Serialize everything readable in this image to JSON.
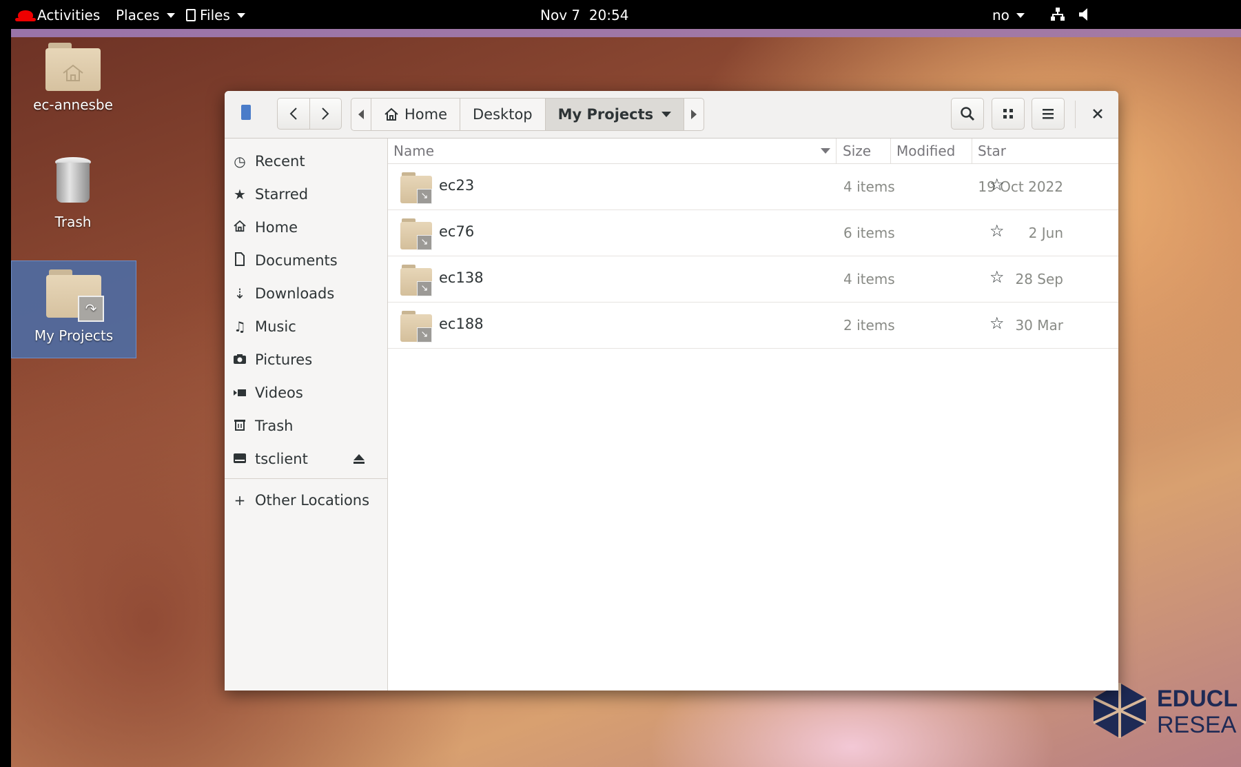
{
  "topbar": {
    "activities": "Activities",
    "places": "Places",
    "files": "Files",
    "clock": "Nov 7  20:54",
    "input_method": "no"
  },
  "desktop": {
    "icons": [
      {
        "label": "ec-annesbe"
      },
      {
        "label": "Trash"
      },
      {
        "label": "My Projects"
      }
    ],
    "logo_line1": "EDUCL",
    "logo_line2": "RESEA"
  },
  "window": {
    "breadcrumbs": [
      "Home",
      "Desktop",
      "My Projects"
    ],
    "sidebar": {
      "items": [
        {
          "label": "Recent",
          "icon": "clock-icon"
        },
        {
          "label": "Starred",
          "icon": "star-icon"
        },
        {
          "label": "Home",
          "icon": "home-icon"
        },
        {
          "label": "Documents",
          "icon": "document-icon"
        },
        {
          "label": "Downloads",
          "icon": "download-icon"
        },
        {
          "label": "Music",
          "icon": "music-icon"
        },
        {
          "label": "Pictures",
          "icon": "camera-icon"
        },
        {
          "label": "Videos",
          "icon": "video-icon"
        },
        {
          "label": "Trash",
          "icon": "trash-icon"
        },
        {
          "label": "tsclient",
          "icon": "drive-icon"
        }
      ],
      "other_locations": "Other Locations"
    },
    "columns": {
      "name": "Name",
      "size": "Size",
      "modified": "Modified",
      "star": "Star"
    },
    "files": [
      {
        "name": "ec23",
        "size": "4 items",
        "modified": "19 Oct 2022"
      },
      {
        "name": "ec76",
        "size": "6 items",
        "modified": "2 Jun"
      },
      {
        "name": "ec138",
        "size": "4 items",
        "modified": "28 Sep"
      },
      {
        "name": "ec188",
        "size": "2 items",
        "modified": "30 Mar"
      }
    ]
  }
}
